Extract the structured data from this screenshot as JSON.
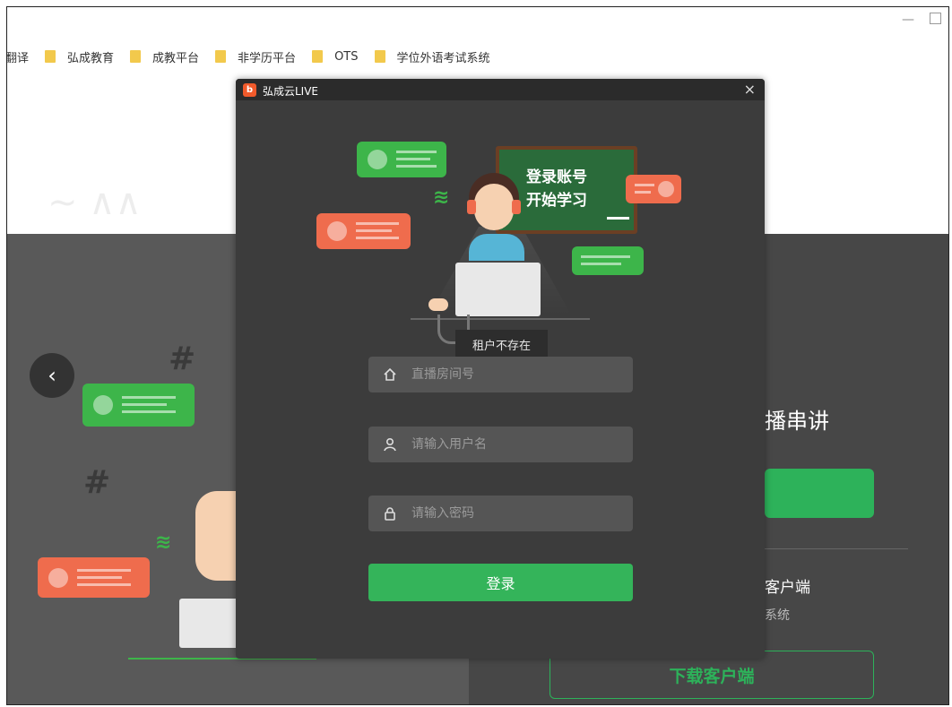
{
  "window": {
    "min_icon": "minimize-icon",
    "max_icon": "maximize-icon"
  },
  "bookmarks": [
    {
      "label": "翻译"
    },
    {
      "label": "弘成教育"
    },
    {
      "label": "成教平台"
    },
    {
      "label": "非学历平台"
    },
    {
      "label": "OTS"
    },
    {
      "label": "学位外语考试系统"
    }
  ],
  "background": {
    "prev_icon": "chevron-left-icon",
    "heading_partial": "播串讲",
    "client_partial": "客户端",
    "system_partial": "系统",
    "download_label": "下载客户端"
  },
  "dialog": {
    "title": "弘成云LIVE",
    "logo_glyph": "b",
    "close_glyph": "×",
    "illustration_text_line1": "登录账号",
    "illustration_text_line2": "开始学习",
    "tooltip": "租户不存在",
    "room_placeholder": "直播房间号",
    "username_placeholder": "请输入用户名",
    "password_placeholder": "请输入密码",
    "login_label": "登录",
    "colors": {
      "accent": "#34b45a",
      "orange": "#ef6c4d",
      "dark_bg": "#3c3c3c"
    }
  }
}
